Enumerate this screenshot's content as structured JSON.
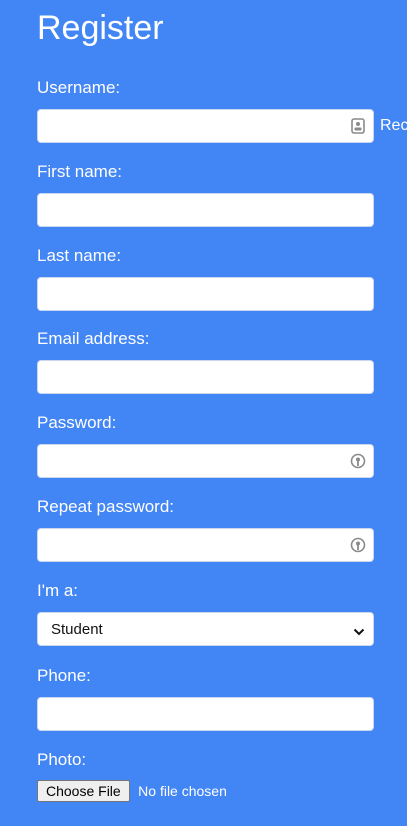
{
  "form": {
    "title": "Register",
    "username": {
      "label": "Username:",
      "value": "",
      "side_text": "Rec"
    },
    "first_name": {
      "label": "First name:",
      "value": ""
    },
    "last_name": {
      "label": "Last name:",
      "value": ""
    },
    "email": {
      "label": "Email address:",
      "value": ""
    },
    "password": {
      "label": "Password:",
      "value": ""
    },
    "repeat_password": {
      "label": "Repeat password:",
      "value": ""
    },
    "role": {
      "label": "I'm a:",
      "selected": "Student"
    },
    "phone": {
      "label": "Phone:",
      "value": ""
    },
    "photo": {
      "label": "Photo:",
      "button_label": "Choose File",
      "status": "No file chosen"
    }
  },
  "icons": {
    "username_autofill": "contact-card-icon",
    "password_key": "key-icon",
    "select_arrow": "chevron-down-icon"
  },
  "colors": {
    "background": "#4285f4",
    "text": "#ffffff",
    "field_background": "#ffffff"
  }
}
